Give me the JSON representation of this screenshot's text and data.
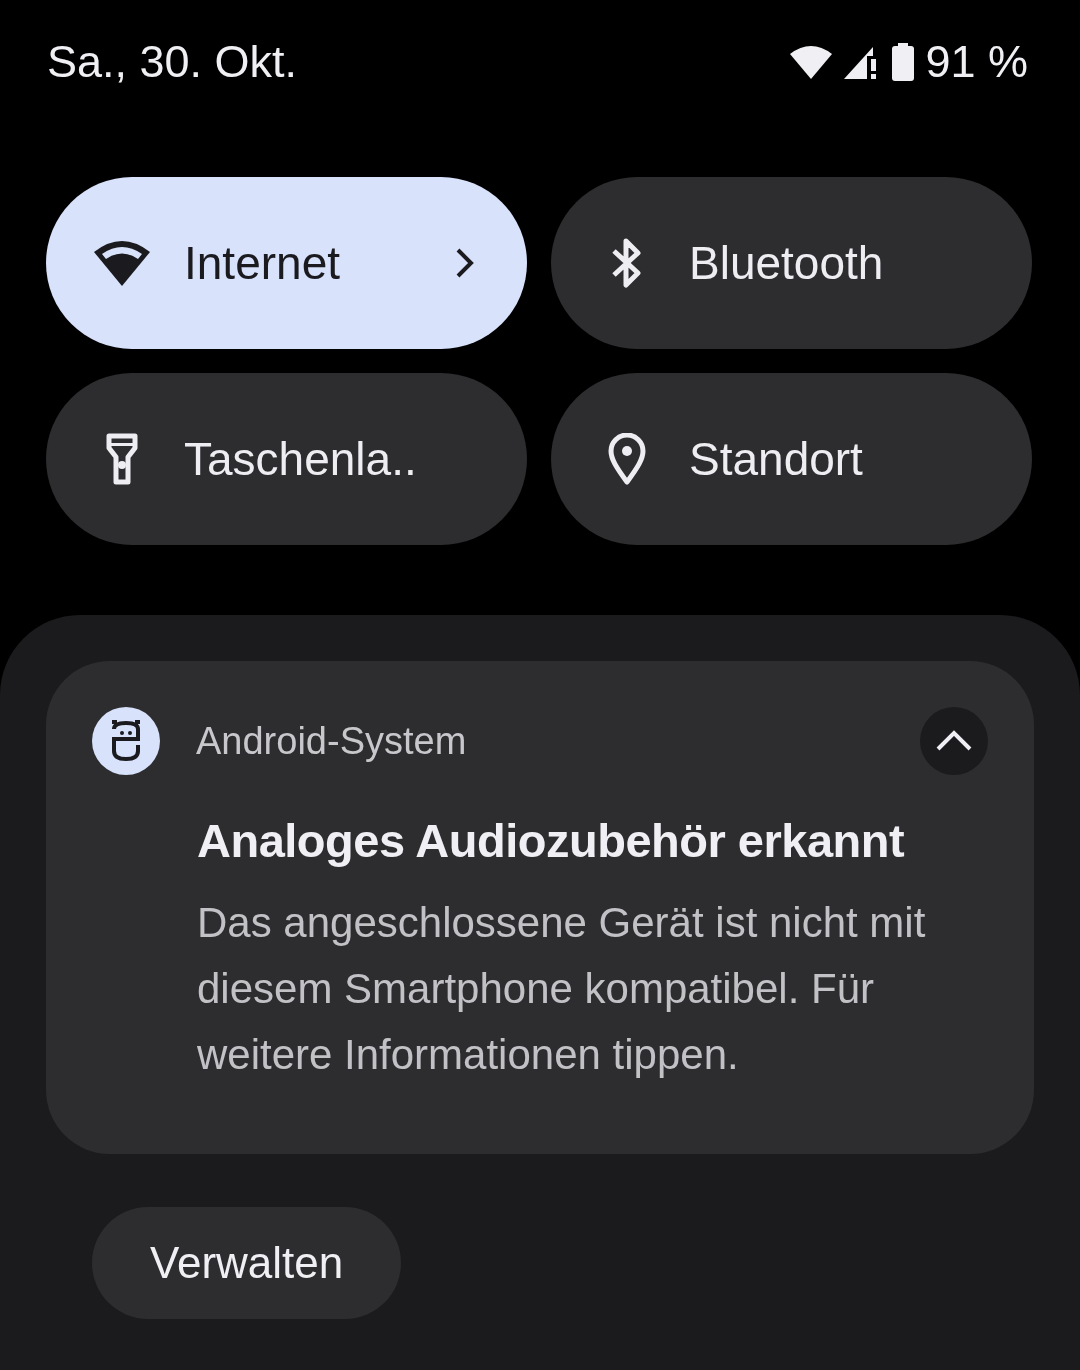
{
  "status_bar": {
    "date": "Sa., 30. Okt.",
    "battery": "91 %"
  },
  "tiles": [
    {
      "kind": "wifi",
      "label": "Internet",
      "on": true,
      "chevron": true
    },
    {
      "kind": "bluetooth",
      "label": "Bluetooth",
      "on": false,
      "chevron": false
    },
    {
      "kind": "flashlight",
      "label": "Taschenla..",
      "on": false,
      "chevron": false
    },
    {
      "kind": "location",
      "label": "Standort",
      "on": false,
      "chevron": false
    }
  ],
  "notification": {
    "app": "Android-System",
    "expanded": true,
    "title": "Analoges Audiozubehör erkannt",
    "body": "Das angeschlossene Gerät ist nicht mit diesem Smartphone kompatibel. Für weitere Informationen tippen.",
    "action": "Verwalten"
  }
}
